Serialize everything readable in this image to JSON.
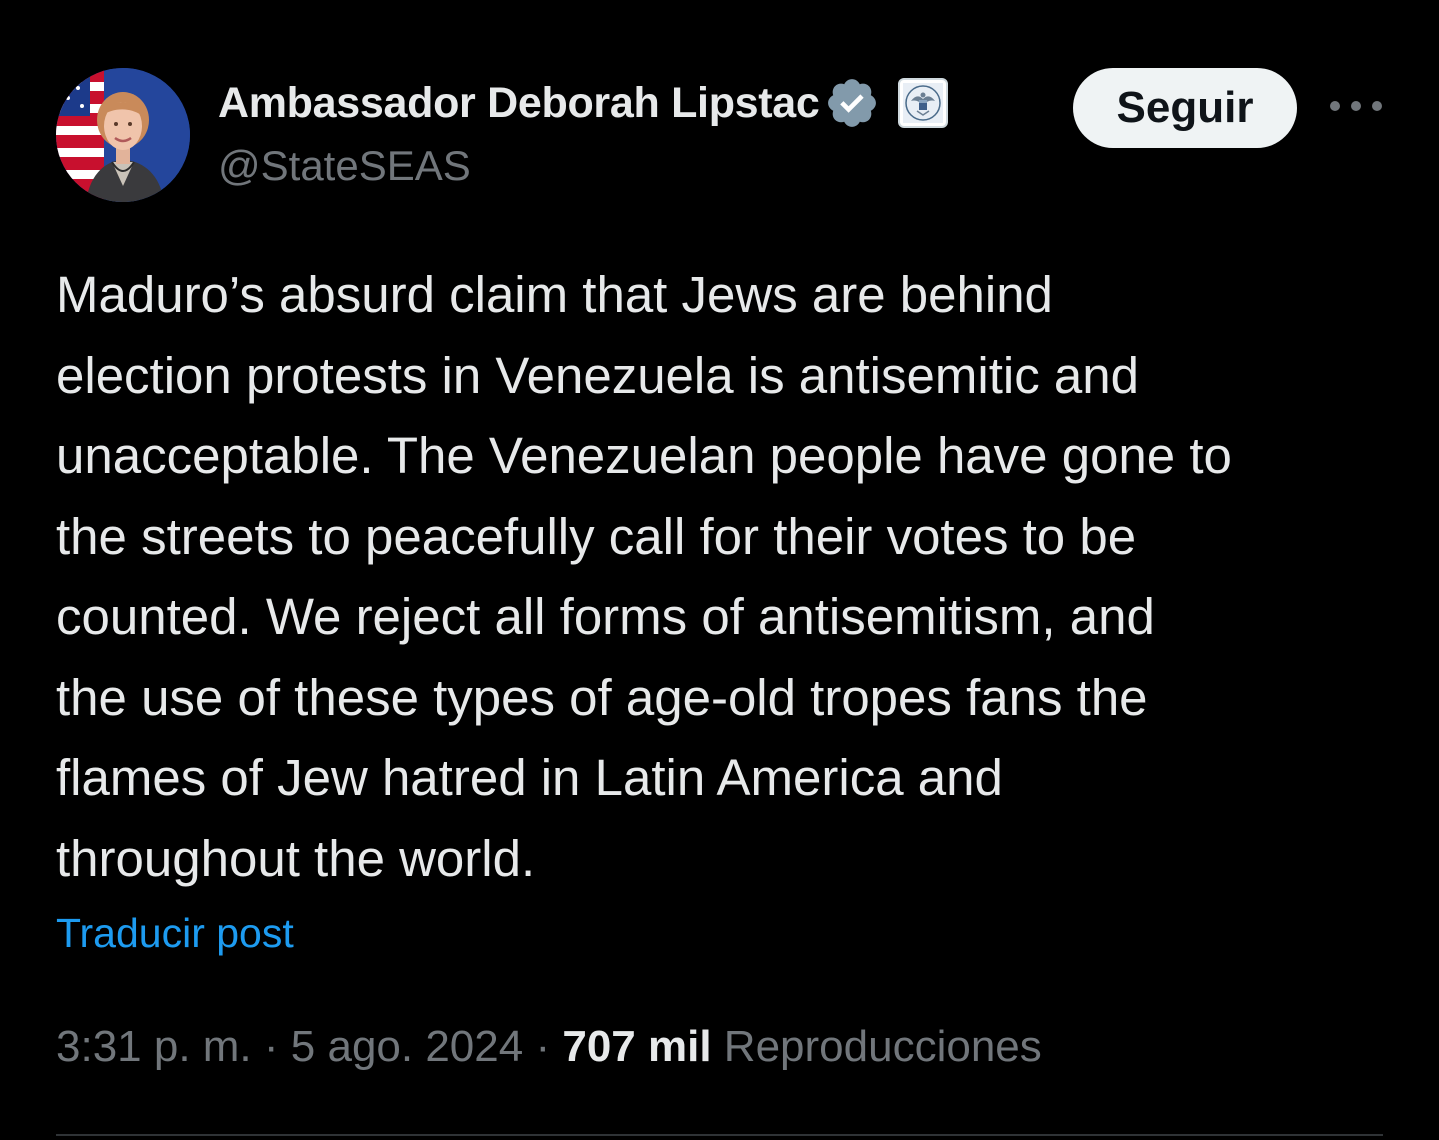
{
  "author": {
    "display_name": "Ambassador Deborah Lipstac",
    "handle": "@StateSEAS",
    "avatar_icon": "avatar-photo",
    "verified_icon": "verified-badge-icon",
    "affiliate_icon": "us-state-department-seal-icon"
  },
  "actions": {
    "follow_label": "Seguir",
    "more_icon": "more-options-icon"
  },
  "post": {
    "text": "Maduro’s absurd claim that Jews are behind\nelection protests in Venezuela is antisemitic and\nunacceptable. The Venezuelan people have gone to\nthe streets to peacefully call for their votes to be\ncounted. We reject all forms of antisemitism, and\nthe use of these types of age-old tropes fans the\nflames of Jew hatred in Latin America and\nthroughout the world.",
    "translate_label": "Traducir post"
  },
  "meta": {
    "time": "3:31 p. m.",
    "separator": " · ",
    "date": "5 ago. 2024",
    "views_count": "707 mil",
    "views_label": "Reproducciones"
  },
  "colors": {
    "background": "#000000",
    "primary_text": "#e7e9ea",
    "secondary_text": "#71767b",
    "link": "#1d9bf0",
    "verified_badge": "#829aab",
    "follow_button_bg": "#eff3f4"
  }
}
